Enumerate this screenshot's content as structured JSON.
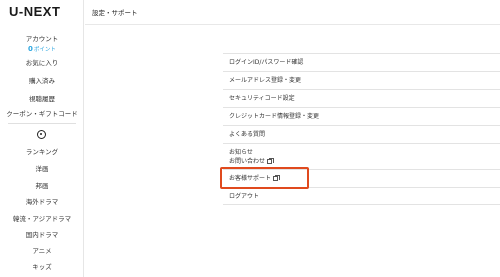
{
  "app": {
    "logo_text": "U-NEXT",
    "page_title": "設定・サポート"
  },
  "sidebar": {
    "account": "アカウント",
    "points_value": "0",
    "points_unit": "ポイント",
    "items": [
      {
        "label": "お気に入り"
      },
      {
        "label": "購入済み"
      },
      {
        "label": "視聴履歴"
      },
      {
        "label": "クーポン・ギフトコード"
      }
    ],
    "categories": [
      {
        "label": "ランキング"
      },
      {
        "label": "洋画"
      },
      {
        "label": "邦画"
      },
      {
        "label": "海外ドラマ"
      },
      {
        "label": "韓流・アジアドラマ"
      },
      {
        "label": "国内ドラマ"
      },
      {
        "label": "アニメ"
      },
      {
        "label": "キッズ"
      }
    ]
  },
  "settings": {
    "items": [
      {
        "label": "ログインID/パスワード確認",
        "external": false
      },
      {
        "label": "メールアドレス登録・変更",
        "external": false
      },
      {
        "label": "セキュリティコード設定",
        "external": false
      },
      {
        "label": "クレジットカード情報登録・変更",
        "external": false
      },
      {
        "label": "よくある質問",
        "external": false
      },
      {
        "label": "お知らせ",
        "external": false
      },
      {
        "label": "お問い合わせ",
        "external": true
      },
      {
        "label": "お客様サポート",
        "external": true,
        "highlighted": true
      },
      {
        "label": "ログアウト",
        "external": false
      }
    ]
  },
  "colors": {
    "highlight": "#e04a1e",
    "points": "#2ca6e0"
  },
  "icons": {
    "menu": "circle-dot-icon",
    "external": "external-window-icon"
  }
}
